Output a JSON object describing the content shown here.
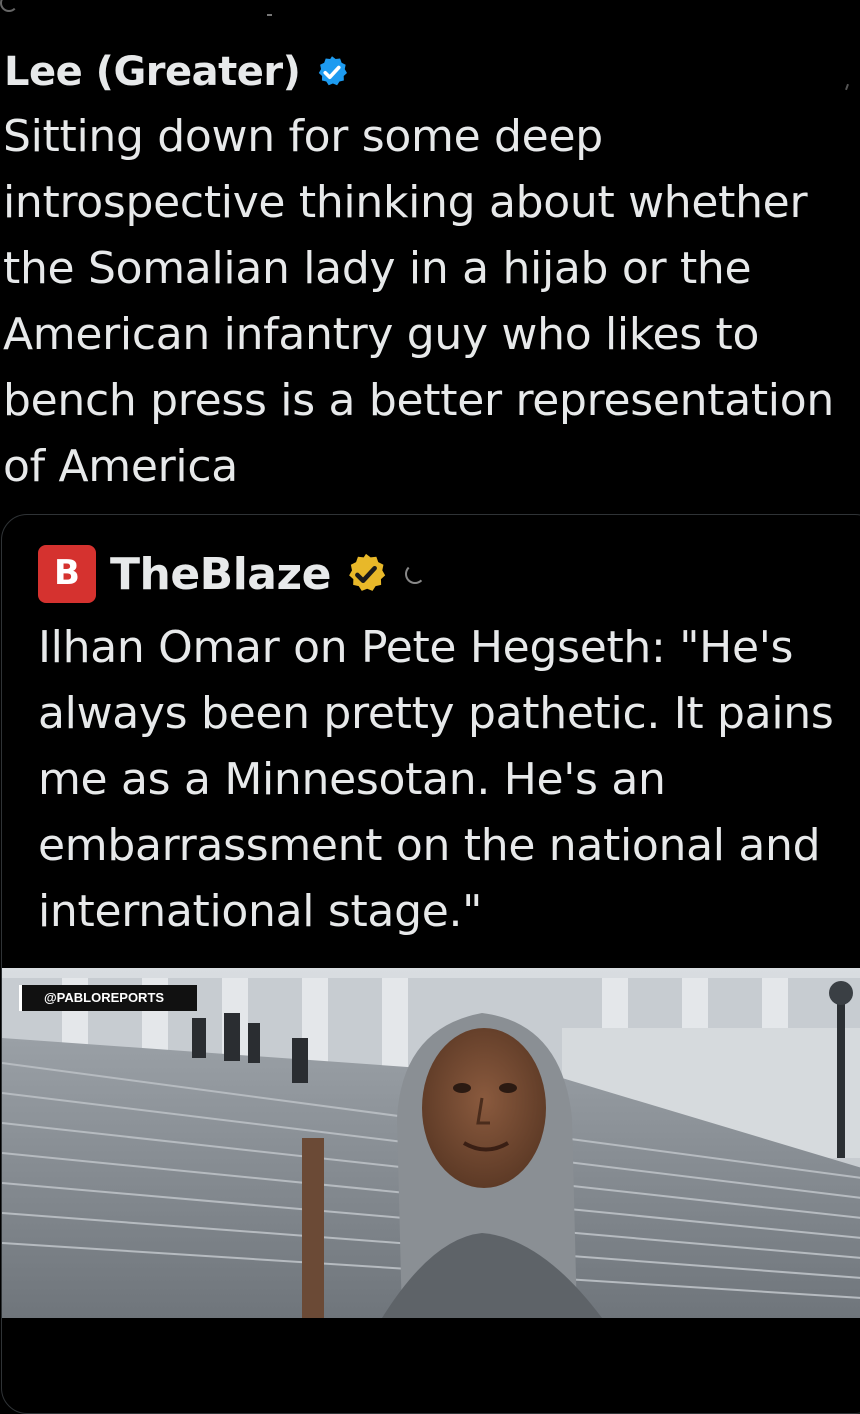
{
  "tweet": {
    "author_name": "Lee (Greater)",
    "verified_icon": "blue-verified-badge-icon",
    "text": "Sitting down for some deep introspective thinking about whether the Somalian lady in a hijab or the American infantry guy who likes to bench press is a better representation of America"
  },
  "quoted_tweet": {
    "author_name": "TheBlaze",
    "avatar_letter": "B",
    "verified_icon": "gold-verified-badge-icon",
    "text": "Ilhan Omar on Pete Hegseth: \"He's always been pretty pathetic. It pains me as a Minnesotan. He's an embarrassment on the national and international stage.\"",
    "media": {
      "watermark": "@PABLOREPORTS",
      "description_icon": "video-still-image"
    }
  },
  "colors": {
    "background": "#000000",
    "text": "#e7e9ea",
    "border": "#2f3336",
    "blue_badge": "#1d9bf0",
    "gold_badge": "#e8b829",
    "blaze_red": "#d5322f"
  }
}
